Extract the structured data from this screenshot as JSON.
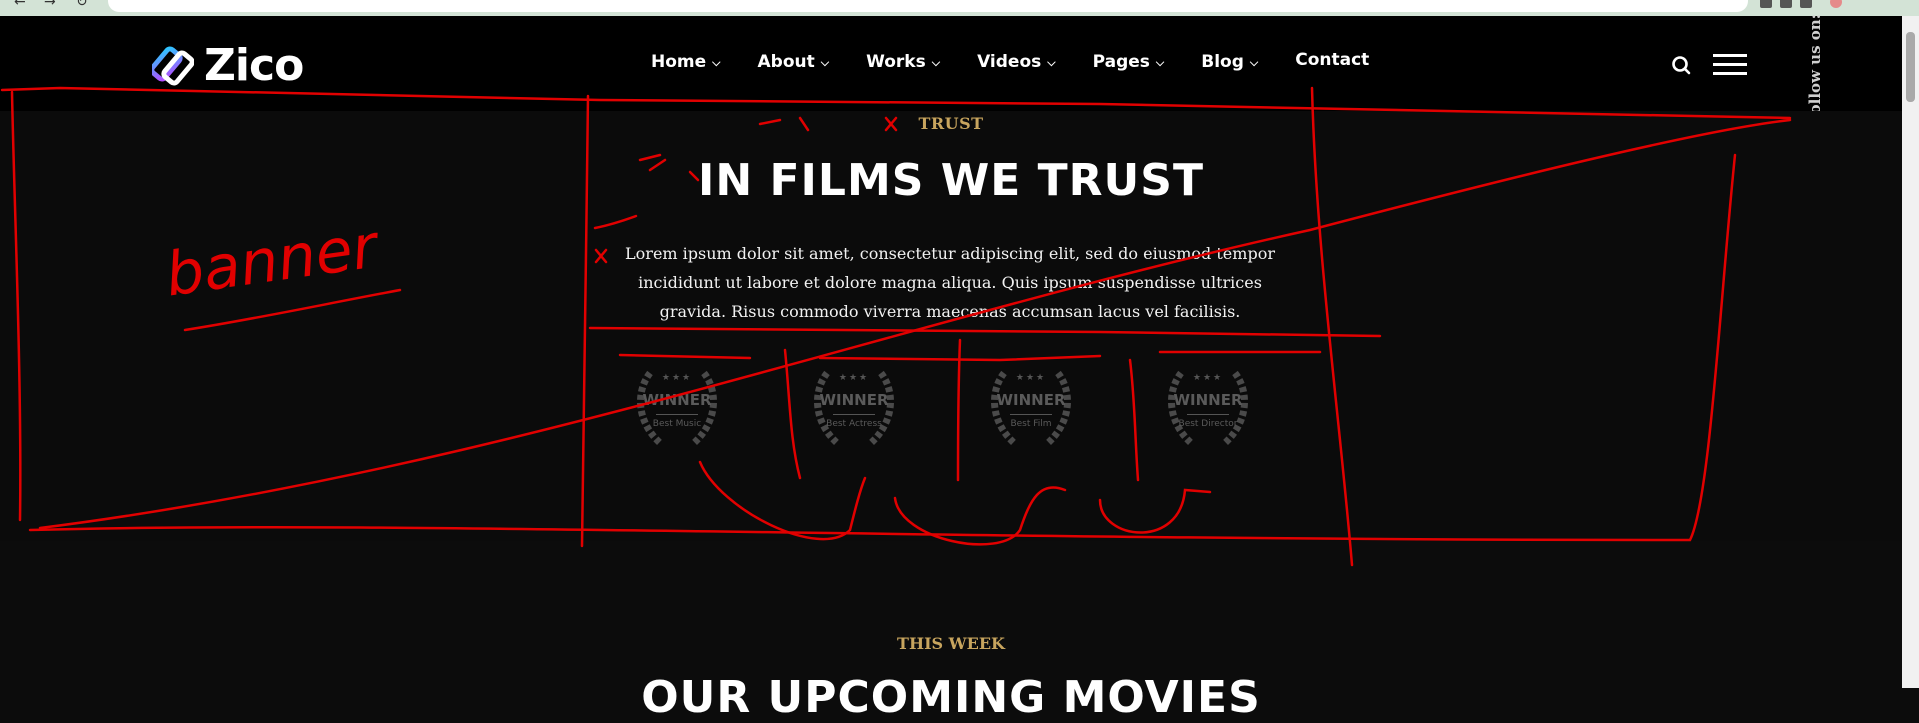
{
  "header": {
    "logo_text": "Zico",
    "nav": [
      {
        "label": "Home",
        "has_dropdown": true
      },
      {
        "label": "About",
        "has_dropdown": true
      },
      {
        "label": "Works",
        "has_dropdown": true
      },
      {
        "label": "Videos",
        "has_dropdown": true
      },
      {
        "label": "Pages",
        "has_dropdown": true
      },
      {
        "label": "Blog",
        "has_dropdown": true
      },
      {
        "label": "Contact",
        "has_dropdown": false
      }
    ],
    "search_icon": "search-icon",
    "menu_icon": "hamburger-menu-icon"
  },
  "social": {
    "follow_text": "Follow us on:"
  },
  "hero": {
    "eyebrow": "TRUST",
    "title": "IN FILMS WE TRUST",
    "description": "Lorem ipsum dolor sit amet, consectetur adipiscing elit, sed do eiusmod tempor incididunt ut labore et dolore magna aliqua. Quis ipsum suspendisse ultrices gravida. Risus commodo viverra maecenas accumsan lacus vel facilisis.",
    "awards": [
      {
        "title": "WINNER",
        "category": "Best Music"
      },
      {
        "title": "WINNER",
        "category": "Best Actress"
      },
      {
        "title": "WINNER",
        "category": "Best Film"
      },
      {
        "title": "WINNER",
        "category": "Best Director"
      }
    ]
  },
  "next_section": {
    "label": "THIS WEEK",
    "title": "OUR UPCOMING MOVIES"
  },
  "annotation": {
    "text": "banner"
  },
  "colors": {
    "accent_gold": "#c8a55e",
    "sketch_red": "#e10000",
    "background": "#0c0c0c"
  }
}
